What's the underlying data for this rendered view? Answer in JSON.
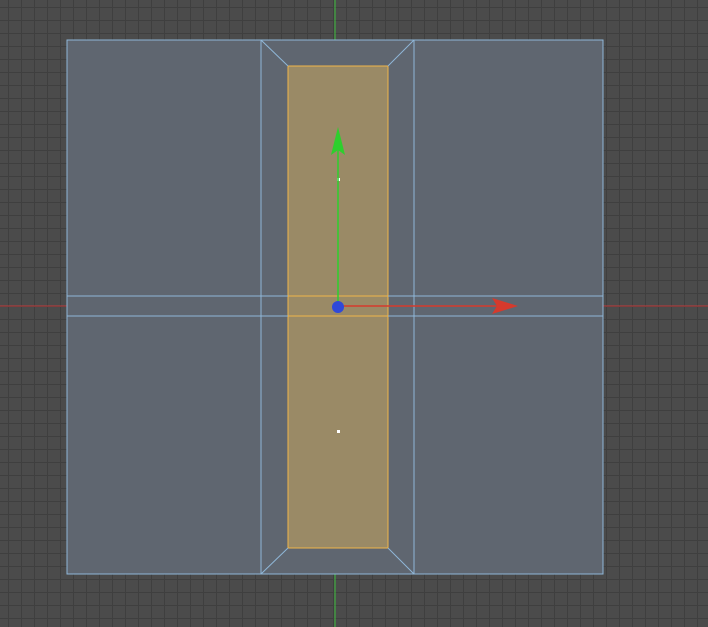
{
  "viewport": {
    "name": "3d-viewport-top-view",
    "grid_visible": true,
    "background_color": "#4b4b4b",
    "grid_line_color": "#3f3f3f"
  },
  "colors": {
    "x_axis": "#c23b3b",
    "y_axis": "#3cbf3c",
    "mesh_face": "#5f6670",
    "mesh_edge": "#8fb7d8",
    "selected_face": "#9a8a66",
    "selected_edge": "#f0b54a",
    "gizmo_center": "#2f49d8",
    "gizmo_x_arrow": "#d63a2c",
    "gizmo_y_arrow": "#2dcf2d"
  },
  "scene": {
    "object_name": "plane-mesh",
    "selection_mode": "face",
    "selected_faces": 1,
    "transform_tool": "move-gizmo",
    "gizmo_axes": [
      "x",
      "y"
    ]
  }
}
